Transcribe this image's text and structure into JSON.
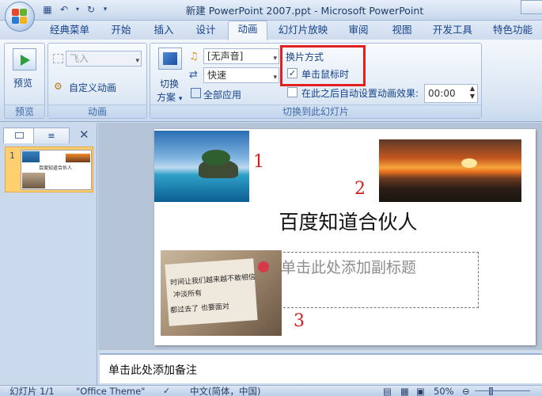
{
  "window": {
    "title": "新建 PowerPoint 2007.ppt - Microsoft PowerPoint",
    "qa_icons": [
      "save-icon",
      "undo-icon",
      "dropdown-icon",
      "redo-icon",
      "customize-icon"
    ]
  },
  "tabs": [
    {
      "label": "经典菜单"
    },
    {
      "label": "开始"
    },
    {
      "label": "插入"
    },
    {
      "label": "设计"
    },
    {
      "label": "动画",
      "active": true
    },
    {
      "label": "幻灯片放映"
    },
    {
      "label": "审阅"
    },
    {
      "label": "视图"
    },
    {
      "label": "开发工具"
    },
    {
      "label": "特色功能"
    }
  ],
  "ribbon": {
    "preview_group": {
      "button": "预览",
      "label": "预览"
    },
    "animation_group": {
      "effect": "飞入",
      "custom": "自定义动画",
      "label": "动画"
    },
    "transition_group": {
      "scheme_line1": "切换",
      "scheme_line2": "方案",
      "sound": "[无声音]",
      "speed": "快速",
      "apply_all": "全部应用",
      "advance_heading": "换片方式",
      "on_click": "单击鼠标时",
      "on_click_checked": true,
      "auto_after": "在此之后自动设置动画效果:",
      "auto_after_checked": false,
      "auto_time": "00:00",
      "label": "切换到此幻灯片"
    }
  },
  "slides_pane": {
    "slide_number": "1",
    "thumb_title": "百度知道合伙人"
  },
  "slide": {
    "title": "百度知道合伙人",
    "subtitle_placeholder": "单击此处添加副标题",
    "numbers": [
      "1",
      "2",
      "3"
    ],
    "note_card_text": [
      "时间让我们越来越不敢相信",
      "冲淡所有",
      "都过去了 也要面对"
    ]
  },
  "notes": {
    "placeholder": "单击此处添加备注"
  },
  "status": {
    "slide": "幻灯片 1/1",
    "theme": "\"Office Theme\"",
    "language": "中文(简体，中国)",
    "zoom": "50%"
  },
  "colors": {
    "annotation_red": "#d11f1f",
    "highlight_box": "#e0211f",
    "selected_thumb": "#ffcf70"
  }
}
